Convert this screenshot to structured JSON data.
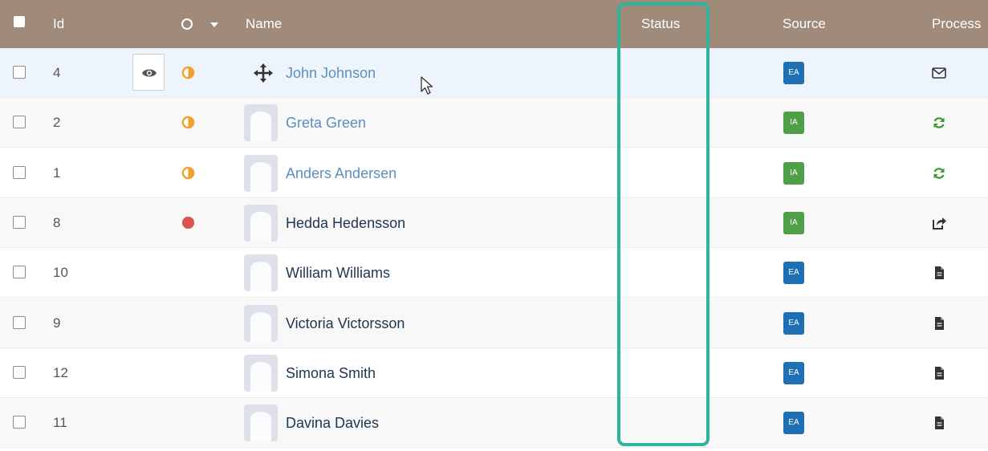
{
  "header": {
    "id_label": "Id",
    "name_label": "Name",
    "status_label": "Status",
    "source_label": "Source",
    "process_label": "Process"
  },
  "rows": [
    {
      "id": "4",
      "name": "John Johnson",
      "status": "half",
      "source": "EA",
      "process": "envelope-icon"
    },
    {
      "id": "2",
      "name": "Greta Green",
      "status": "half",
      "source": "IA",
      "process": "refresh-icon"
    },
    {
      "id": "1",
      "name": "Anders Andersen",
      "status": "half",
      "source": "IA",
      "process": "refresh-icon"
    },
    {
      "id": "8",
      "name": "Hedda Hedensson",
      "status": "red",
      "source": "IA",
      "process": "share-icon"
    },
    {
      "id": "10",
      "name": "William Williams",
      "status": "none",
      "source": "EA",
      "process": "document-icon"
    },
    {
      "id": "9",
      "name": "Victoria Victorsson",
      "status": "none",
      "source": "EA",
      "process": "document-icon"
    },
    {
      "id": "12",
      "name": "Simona Smith",
      "status": "none",
      "source": "EA",
      "process": "document-icon"
    },
    {
      "id": "11",
      "name": "Davina Davies",
      "status": "none",
      "source": "EA",
      "process": "document-icon"
    }
  ],
  "colors": {
    "header_bg": "#a08a79",
    "highlight": "#2fb59c",
    "ea_badge": "#1f6fb5",
    "ia_badge": "#4e9f47",
    "status_half": "#f0a030",
    "status_red": "#d9534f",
    "link": "#5b8fc0"
  }
}
